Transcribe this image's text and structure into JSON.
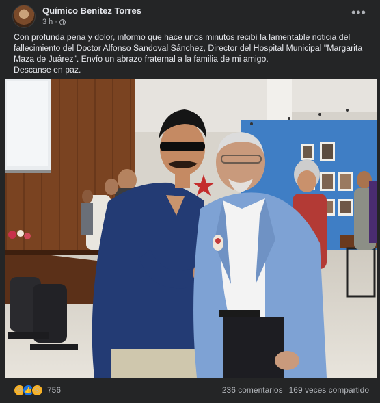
{
  "post": {
    "author": "Químico Benitez Torres",
    "time": "3 h",
    "menu_icon": "more-dots-icon",
    "privacy_icon": "globe-icon",
    "text_line_1": "Con profunda pena y dolor, informo que hace unos minutos recibí la lamentable noticia del",
    "text_line_2": "fallecimiento del Doctor Alfonso Sandoval Sánchez, Director del Hospital Municipal \"Margarita",
    "text_line_3": "Maza de Juárez\". Envío un abrazo fraternal a la familia de mi amigo.",
    "text_line_4": "Descanse en paz."
  },
  "footer": {
    "reaction_icons": [
      "sad-reaction-icon",
      "like-reaction-icon",
      "wow-reaction-icon"
    ],
    "reaction_count": "756",
    "comments": "236 comentarios",
    "shares": "169 veces compartido"
  },
  "colors": {
    "background": "#242526",
    "text": "#e4e6eb",
    "secondary_text": "#b0b3b8",
    "like_blue": "#1b74e4"
  }
}
